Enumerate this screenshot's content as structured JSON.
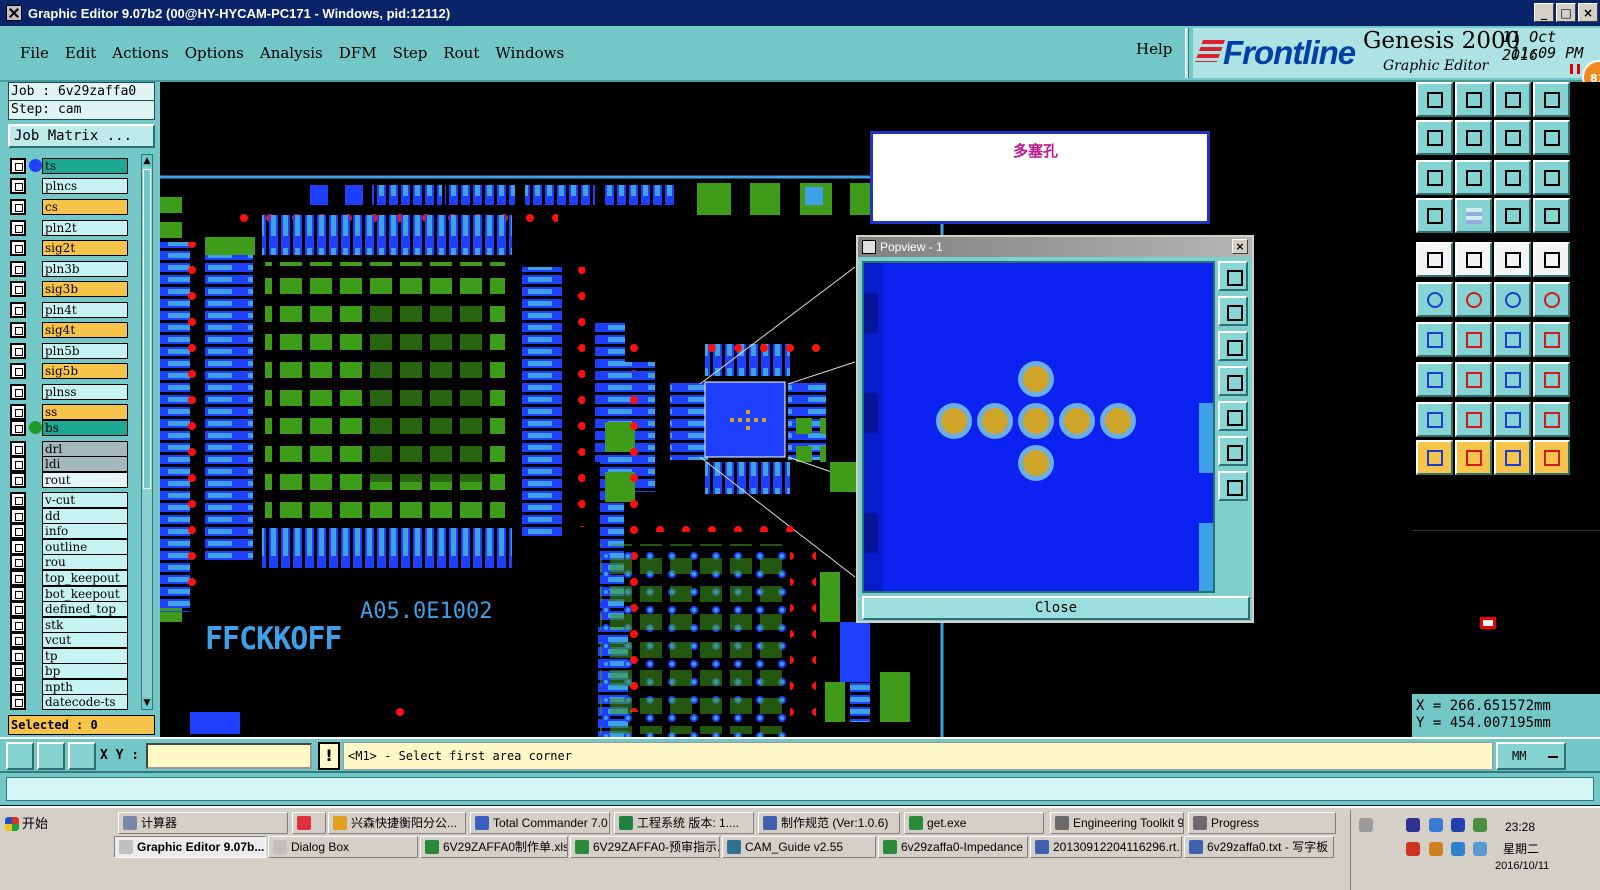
{
  "window": {
    "title": "Graphic Editor 9.07b2 (00@HY-HYCAM-PC171 - Windows, pid:12112)"
  },
  "menu": {
    "items": [
      "File",
      "Edit",
      "Actions",
      "Options",
      "Analysis",
      "DFM",
      "Step",
      "Rout",
      "Windows"
    ],
    "help": "Help"
  },
  "brand": {
    "logo": "Frontline",
    "product": "Genesis 2000",
    "subtitle": "Graphic Editor",
    "date": "11 Oct 2016",
    "time": "11:09 PM",
    "badge": "81"
  },
  "job": {
    "job_line": "Job : 6v29zaffa0",
    "step_line": "Step: cam",
    "matrix_button": "Job Matrix ..."
  },
  "layers": [
    {
      "name": "ts",
      "color": "teal",
      "dot": "#1f3fff"
    },
    {
      "name": "plncs",
      "color": "cyan"
    },
    {
      "name": "cs",
      "color": "orange"
    },
    {
      "name": "pln2t",
      "color": "cyan"
    },
    {
      "name": "sig2t",
      "color": "orange"
    },
    {
      "name": "pln3b",
      "color": "cyan"
    },
    {
      "name": "sig3b",
      "color": "orange"
    },
    {
      "name": "pln4t",
      "color": "cyan"
    },
    {
      "name": "sig4t",
      "color": "orange"
    },
    {
      "name": "pln5b",
      "color": "cyan"
    },
    {
      "name": "sig5b",
      "color": "orange"
    },
    {
      "name": "plnss",
      "color": "cyan"
    },
    {
      "name": "ss",
      "color": "orange"
    },
    {
      "name": "bs",
      "color": "teal",
      "dot": "#1f9a2a"
    },
    {
      "name": "drl",
      "color": "grey"
    },
    {
      "name": "ldi",
      "color": "grey"
    },
    {
      "name": "rout",
      "color": "white"
    },
    {
      "name": "v-cut",
      "color": "cyan"
    },
    {
      "name": "dd",
      "color": "cyan"
    },
    {
      "name": "info",
      "color": "cyan"
    },
    {
      "name": "outline",
      "color": "cyan"
    },
    {
      "name": "rou",
      "color": "cyan"
    },
    {
      "name": "top_keepout",
      "color": "cyan"
    },
    {
      "name": "bot_keepout",
      "color": "cyan"
    },
    {
      "name": "defined_top",
      "color": "cyan"
    },
    {
      "name": "stk",
      "color": "cyan"
    },
    {
      "name": "vcut",
      "color": "cyan"
    },
    {
      "name": "tp",
      "color": "cyan"
    },
    {
      "name": "bp",
      "color": "cyan"
    },
    {
      "name": "npth",
      "color": "cyan"
    },
    {
      "name": "datecode-ts",
      "color": "cyan"
    }
  ],
  "selected": "Selected : 0",
  "info_popup": {
    "text": "多塞孔"
  },
  "popview": {
    "title": "Popview - 1",
    "close_label": "Close"
  },
  "board_text": {
    "silk1": "FFCKKOFF",
    "silk2": "A05.0E1002"
  },
  "coords": {
    "x": "X = 266.651572mm",
    "y": "Y = 454.007195mm"
  },
  "command": {
    "xy_label": "X Y :",
    "xy_value": "",
    "bang": "!",
    "prompt": "<M1> - Select first area corner",
    "units": "MM"
  },
  "taskbar": {
    "start": "开始",
    "row1": [
      {
        "label": "计算器",
        "icon": "#7a86a8"
      },
      {
        "label": "",
        "icon": "#e0303a"
      },
      {
        "label": "兴森快捷衡阳分公...",
        "icon": "#e0a020"
      },
      {
        "label": "Total Commander 7.0 ...",
        "icon": "#3a60c0"
      },
      {
        "label": "工程系统  版本: 1....",
        "icon": "#208040"
      },
      {
        "label": "制作规范 (Ver:1.0.6)",
        "icon": "#4060b0"
      },
      {
        "label": "get.exe",
        "icon": "#2a8a3a"
      },
      {
        "label": "Engineering Toolkit 9....",
        "icon": "#6a6a6a"
      },
      {
        "label": "Progress",
        "icon": "#6a6a6a"
      }
    ],
    "row2": [
      {
        "label": "Graphic Editor 9.07b...",
        "icon": "#c0c0c0",
        "active": true
      },
      {
        "label": "Dialog Box",
        "icon": "#c0c0c0"
      },
      {
        "label": "6V29ZAFFA0制作单.xls...",
        "icon": "#2a8a3a"
      },
      {
        "label": "6V29ZAFFA0-预审指示...",
        "icon": "#2a8a3a"
      },
      {
        "label": "CAM_Guide v2.55",
        "icon": "#307090"
      },
      {
        "label": "6v29zaffa0-Impedance ...",
        "icon": "#2a8a3a"
      },
      {
        "label": "20130912204116296.rt...",
        "icon": "#4060b0"
      },
      {
        "label": "6v29zaffa0.txt - 写字板",
        "icon": "#4060b0"
      }
    ],
    "clock": {
      "time": "23:28",
      "weekday": "星期二",
      "date": "2016/10/11"
    }
  }
}
